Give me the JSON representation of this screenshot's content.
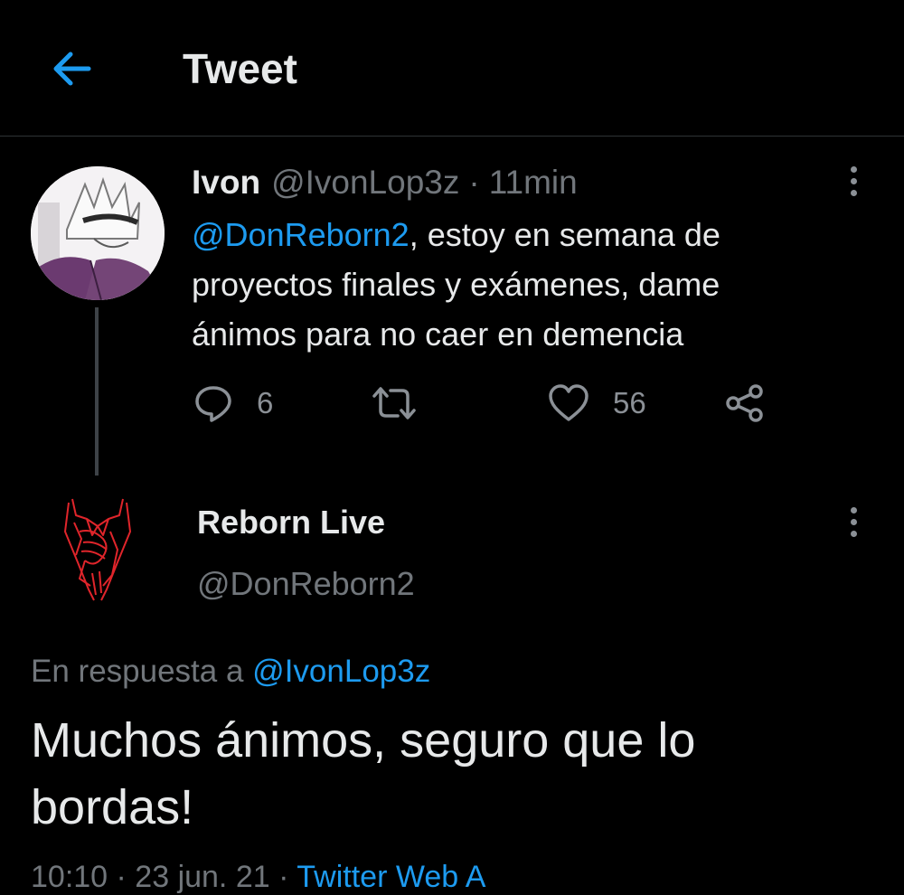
{
  "header": {
    "title": "Tweet",
    "back_icon": "arrow-left-icon",
    "accent_color": "#1d9bf0"
  },
  "parent_tweet": {
    "author_name": "Ivon",
    "author_handle": "@IvonLop3z",
    "separator": "·",
    "time": "11min",
    "mention": "@DonReborn2",
    "text": ", estoy en semana de proyectos finales y exámenes, dame ánimos para no caer en demencia",
    "actions": {
      "reply_count": "6",
      "like_count": "56"
    }
  },
  "reply_tweet": {
    "author_name": "Reborn Live",
    "author_handle": "@DonReborn2",
    "reply_to_prefix": "En respuesta a",
    "reply_to_handle": "@IvonLop3z",
    "text": "Muchos ánimos, seguro que lo bordas!",
    "footer_partial": "10:10 · 23 jun. 21 ·",
    "footer_client_partial": "Twitter Web A"
  },
  "colors": {
    "background": "#000000",
    "text_primary": "#e7e9ea",
    "text_secondary": "#71767b",
    "link": "#1d9bf0",
    "divider": "#2f3336",
    "logo_red": "#e0252b"
  }
}
